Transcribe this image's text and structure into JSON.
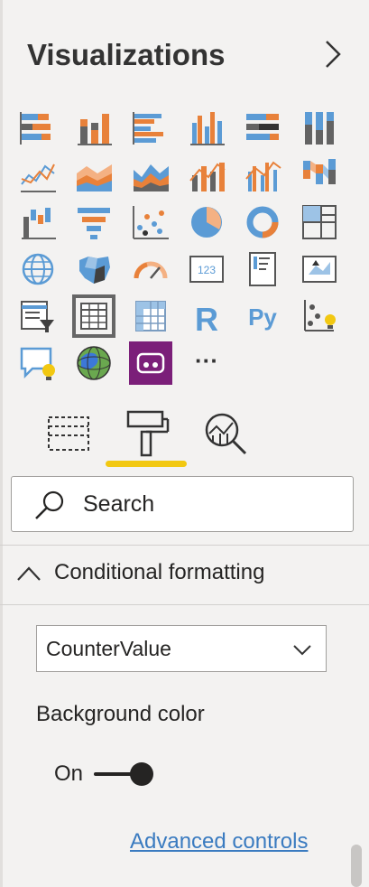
{
  "pane": {
    "title": "Visualizations",
    "expand_icon": "chevron-right-icon"
  },
  "visuals": [
    {
      "name": "stacked-bar-chart-icon"
    },
    {
      "name": "stacked-column-chart-icon"
    },
    {
      "name": "clustered-bar-chart-icon"
    },
    {
      "name": "clustered-column-chart-icon"
    },
    {
      "name": "100pct-stacked-bar-chart-icon"
    },
    {
      "name": "100pct-stacked-column-chart-icon"
    },
    {
      "name": "line-chart-icon"
    },
    {
      "name": "area-chart-icon"
    },
    {
      "name": "stacked-area-chart-icon"
    },
    {
      "name": "line-and-stacked-column-chart-icon"
    },
    {
      "name": "line-and-clustered-column-chart-icon"
    },
    {
      "name": "ribbon-chart-icon"
    },
    {
      "name": "waterfall-chart-icon"
    },
    {
      "name": "funnel-icon"
    },
    {
      "name": "scatter-chart-icon"
    },
    {
      "name": "pie-chart-icon"
    },
    {
      "name": "donut-chart-icon"
    },
    {
      "name": "treemap-icon"
    },
    {
      "name": "map-icon"
    },
    {
      "name": "filled-map-icon"
    },
    {
      "name": "gauge-icon"
    },
    {
      "name": "card-icon",
      "text": "123"
    },
    {
      "name": "multi-row-card-icon"
    },
    {
      "name": "kpi-icon"
    },
    {
      "name": "slicer-icon"
    },
    {
      "name": "table-icon",
      "selected": true
    },
    {
      "name": "matrix-icon"
    },
    {
      "name": "r-script-visual-icon",
      "text": "R"
    },
    {
      "name": "python-visual-icon",
      "text": "Py"
    },
    {
      "name": "key-influencers-icon"
    },
    {
      "name": "qa-icon"
    },
    {
      "name": "globe-map-icon"
    },
    {
      "name": "custom-visual-icon"
    },
    {
      "name": "more-visuals-icon",
      "text": "···"
    }
  ],
  "tabs": [
    {
      "name": "fields-tab-icon"
    },
    {
      "name": "format-tab-icon",
      "active": true
    },
    {
      "name": "analytics-tab-icon"
    }
  ],
  "search": {
    "label": "Search",
    "icon": "search-icon"
  },
  "section": {
    "label": "Conditional formatting",
    "icon": "chevron-up-icon"
  },
  "dropdown": {
    "value": "CounterValue",
    "icon": "chevron-down-icon"
  },
  "background": {
    "label": "Background color",
    "toggle_label": "On",
    "toggle_on": true
  },
  "advanced_link": "Advanced controls",
  "colors": {
    "accent": "#f2c811",
    "orange": "#e8813a",
    "blue": "#5b9bd5",
    "gray": "#636363",
    "link": "#3a7bc0",
    "purple": "#7b1f79"
  }
}
